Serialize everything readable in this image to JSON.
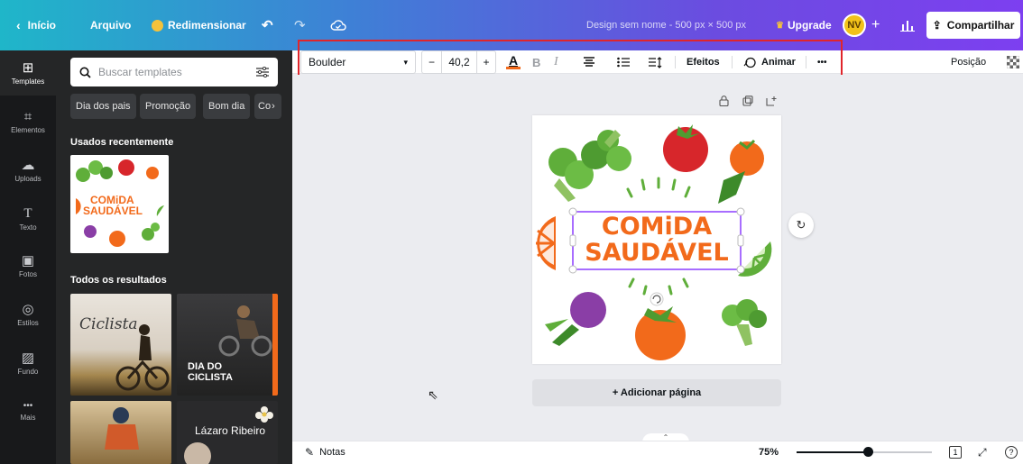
{
  "topbar": {
    "home": "Início",
    "file": "Arquivo",
    "resize": "Redimensionar",
    "design_title": "Design sem nome - 500 px × 500 px",
    "upgrade": "Upgrade",
    "avatar_initials": "NV",
    "plus": "+",
    "share": "Compartilhar"
  },
  "rail": {
    "items": [
      {
        "label": "Templates",
        "icon": "template-icon"
      },
      {
        "label": "Elementos",
        "icon": "elements-icon"
      },
      {
        "label": "Uploads",
        "icon": "upload-icon"
      },
      {
        "label": "Texto",
        "icon": "text-icon"
      },
      {
        "label": "Fotos",
        "icon": "photo-icon"
      },
      {
        "label": "Estilos",
        "icon": "styles-icon"
      },
      {
        "label": "Fundo",
        "icon": "background-icon"
      },
      {
        "label": "Mais",
        "icon": "more-icon"
      }
    ]
  },
  "panel": {
    "search_placeholder": "Buscar templates",
    "chips": [
      "Dia dos pais",
      "Promoção",
      "Bom dia",
      "Co"
    ],
    "recent_title": "Usados recentemente",
    "recent_thumb_text": [
      "COMiDA",
      "SAUDÁVEL"
    ],
    "all_results_title": "Todos os resultados",
    "result1_text": "Ciclista",
    "result2_text": [
      "DIA DO",
      "CICLISTA"
    ],
    "result4_text": "Lázaro Ribeiro"
  },
  "toolbar": {
    "font": "Boulder",
    "minus": "−",
    "size": "40,2",
    "plus": "+",
    "text_color_glyph": "A",
    "bold": "B",
    "italic": "I",
    "effects": "Efeitos",
    "animate": "Animar",
    "more": "•••",
    "position": "Posição"
  },
  "canvas": {
    "title_line1": "COMiDA",
    "title_line2": "SAUDÁVEL",
    "add_page": "+ Adicionar página"
  },
  "bottombar": {
    "notes": "Notas",
    "zoom": "75%",
    "zoom_fraction": 0.53,
    "page_count": "1",
    "help": "?"
  },
  "colors": {
    "orange": "#f26a1b",
    "purple": "#8a4fd8",
    "green": "#5fae3a",
    "red": "#d7262b"
  }
}
